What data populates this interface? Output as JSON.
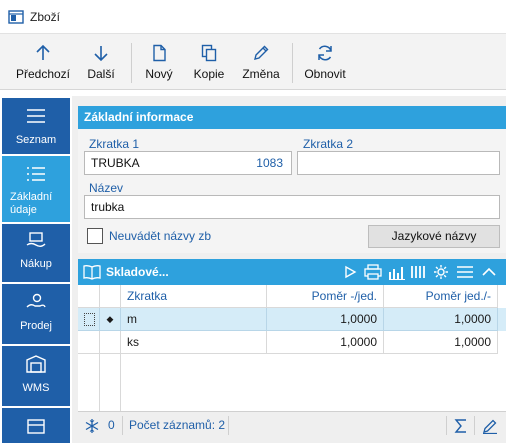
{
  "window": {
    "title": "Zboží"
  },
  "toolbar": {
    "prev_label": "Předchozí",
    "next_label": "Další",
    "new_label": "Nový",
    "copy_label": "Kopie",
    "edit_label": "Změna",
    "refresh_label": "Obnovit"
  },
  "sidebar": {
    "items": [
      {
        "label": "Seznam",
        "icon": "list-icon"
      },
      {
        "label": "Základní údaje",
        "icon": "details-icon"
      },
      {
        "label": "Nákup",
        "icon": "purchase-icon"
      },
      {
        "label": "Prodej",
        "icon": "sales-icon"
      },
      {
        "label": "WMS",
        "icon": "warehouse-icon"
      }
    ]
  },
  "basic_info": {
    "header": "Základní informace",
    "zkratka1_label": "Zkratka 1",
    "zkratka1_value": "TRUBKA",
    "zkratka1_number": "1083",
    "zkratka2_label": "Zkratka 2",
    "zkratka2_value": "",
    "nazev_label": "Název",
    "nazev_value": "trubka",
    "checkbox_label": "Neuvádět názvy zb",
    "checkbox_checked": false,
    "lang_button": "Jazykové názvy"
  },
  "stock_grid": {
    "title": "Skladové...",
    "columns": [
      "Zkratka",
      "Poměr -/jed.",
      "Poměr jed./-"
    ],
    "rows": [
      {
        "marker": "◆",
        "zkratka": "m",
        "pomer1": "1,0000",
        "pomer2": "1,0000",
        "selected": true
      },
      {
        "marker": "",
        "zkratka": "ks",
        "pomer1": "1,0000",
        "pomer2": "1,0000",
        "selected": false
      }
    ],
    "status_filter_count": "0",
    "status_records": "Počet záznamů: 2"
  },
  "colors": {
    "accent": "#2ea1dd",
    "sidebar": "#1f5fa8",
    "selection": "#d5ecf8"
  }
}
